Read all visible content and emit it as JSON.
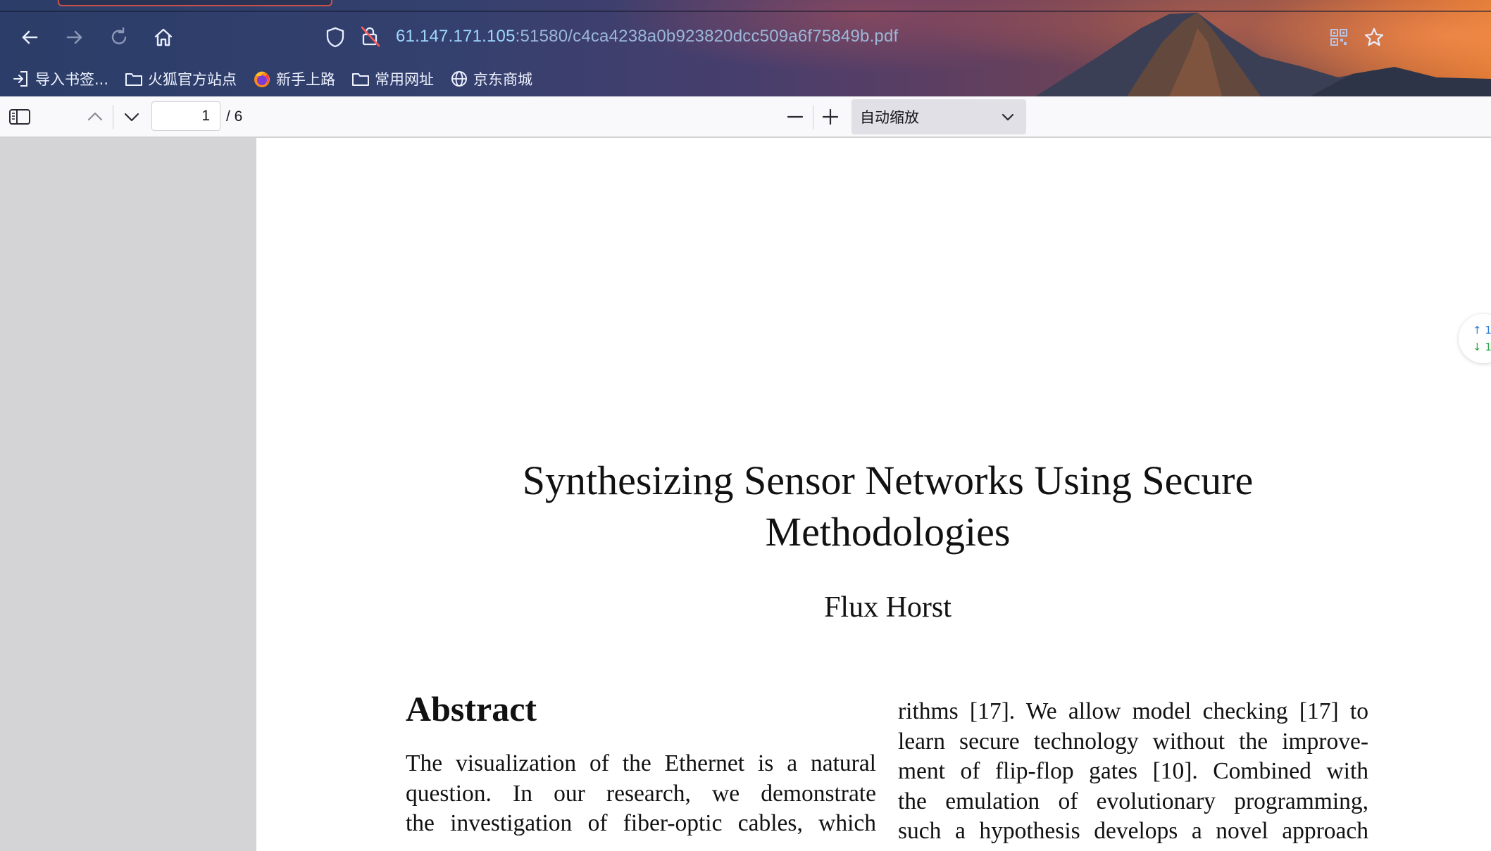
{
  "browser": {
    "url_host": "61.147.171.105",
    "url_rest": ":51580/c4ca4238a0b923820dcc509a6f75849b.pdf",
    "icons": [
      "back-arrow-icon",
      "forward-arrow-icon",
      "reload-icon",
      "home-icon",
      "shield-icon",
      "lock-warning-icon",
      "qr-code-icon",
      "star-icon"
    ]
  },
  "bookmarks": [
    {
      "label": "导入书签...",
      "icon": "import-icon"
    },
    {
      "label": "火狐官方站点",
      "icon": "folder-icon"
    },
    {
      "label": "新手上路",
      "icon": "firefox-icon"
    },
    {
      "label": "常用网址",
      "icon": "folder-icon"
    },
    {
      "label": "京东商城",
      "icon": "globe-icon"
    }
  ],
  "pdf_toolbar": {
    "current_page": "1",
    "total_pages": "/ 6",
    "zoom": "自动缩放"
  },
  "paper": {
    "title_line1": "Synthesizing Sensor Networks Using Secure",
    "title_line2": "Methodologies",
    "author": "Flux Horst",
    "abstract_heading": "Abstract",
    "left_column": [
      "The visualization of the Ethernet is a natural",
      "question. In our research, we demonstrate",
      "the investigation of fiber-optic cables, which"
    ],
    "right_column": [
      "rithms [17]. We allow model checking [17] to",
      "learn secure technology without the improve-",
      "ment of flip-flop gates [10]. Combined with",
      "the emulation of evolutionary programming,",
      "such a hypothesis develops a novel approach"
    ]
  },
  "widget": {
    "up": "↑ 1",
    "down": "↓ 1"
  },
  "colors": {
    "url_host": "#9ed8ff",
    "url_rest": "#9bb7d9",
    "toolbar_bg": "#f9f9fb",
    "viewer_bg": "#d4d4d7"
  }
}
